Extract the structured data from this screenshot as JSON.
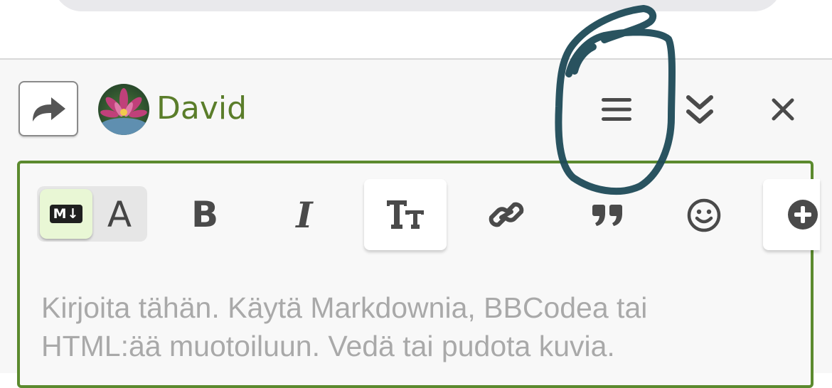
{
  "header": {
    "reply_icon": "share-arrow-icon",
    "user_name": "David",
    "menu_icon": "hamburger-menu-icon",
    "collapse_icon": "double-chevron-down-icon",
    "close_icon": "close-icon"
  },
  "toolbar": {
    "markdown_badge": "M↓",
    "rich_text_label": "A",
    "bold_label": "B",
    "italic_label": "I",
    "items": [
      "markdown-toggle",
      "bold",
      "italic",
      "heading",
      "link",
      "quote",
      "emoji",
      "more"
    ]
  },
  "editor": {
    "placeholder": "Kirjoita tähän. Käytä Markdownia, BBCodea tai\nHTML:ää muotoiluun. Vedä tai pudota kuvia."
  },
  "colors": {
    "accent_green": "#5b8a2e",
    "name_green": "#5a7d2a",
    "annotation_stroke": "#1e4a57"
  }
}
